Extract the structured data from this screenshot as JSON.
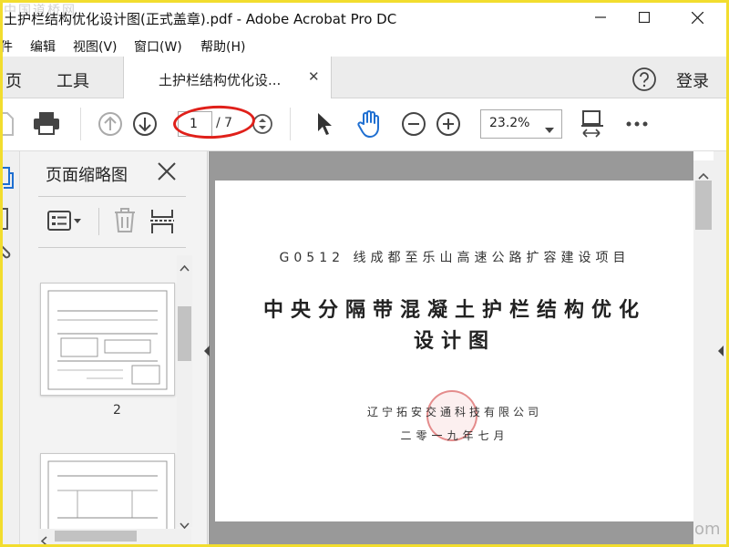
{
  "window": {
    "title": "土护栏结构优化设计图(正式盖章).pdf - Adobe Acrobat Pro DC"
  },
  "menu": {
    "items": [
      "件",
      "编辑",
      "视图(V)",
      "窗口(W)",
      "帮助(H)"
    ]
  },
  "tabs": {
    "home": "主页",
    "tools": "工具",
    "document": "土护栏结构优化设...",
    "login": "登录"
  },
  "toolbar": {
    "page_current": "1",
    "page_total": "/ 7",
    "zoom": "23.2%"
  },
  "thumbnail_panel": {
    "title": "页面缩略图",
    "thumb_label": "2"
  },
  "document": {
    "line1": "G0512 线成都至乐山高速公路扩容建设项目",
    "line2": "中央分隔带混凝土护栏结构优化",
    "line3": "设计图",
    "company": "辽宁拓安交通科技有限公司",
    "date": "二零一九年七月"
  },
  "watermark": {
    "top_left": "中国道桥网",
    "bottom_right": "om"
  },
  "colors": {
    "accent_blue": "#1f6fd1",
    "annotation_red": "#e0201a",
    "frame_yellow": "#f2dd2e"
  }
}
